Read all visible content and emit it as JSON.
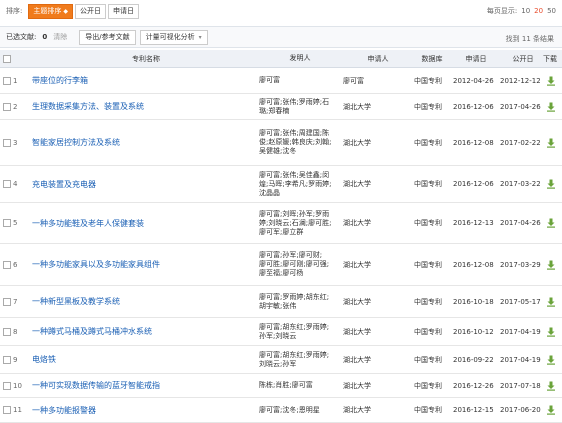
{
  "sortbar": {
    "label": "排序:",
    "buttons": [
      {
        "label": "主题排序",
        "arrow": "◆",
        "active": true
      },
      {
        "label": "公开日",
        "active": false
      },
      {
        "label": "申请日",
        "active": false
      }
    ],
    "perpage_label": "每页显示:",
    "perpage_options": [
      "10",
      "20",
      "50"
    ],
    "perpage_selected": "20"
  },
  "toolbar": {
    "selected_label": "已选文献:",
    "selected_count": "0",
    "clear_label": "清除",
    "export_label": "导出/参考文献",
    "analysis_label": "计量可视化分析",
    "found_text": "找到 11 条结果"
  },
  "table": {
    "headers": {
      "title": "专利名称",
      "inventor": "发明人",
      "applicant": "申请人",
      "database": "数据库",
      "apply_date": "申请日",
      "pub_date": "公开日",
      "download": "下载"
    },
    "rows": [
      {
        "num": "1",
        "title": "带座位的行李箱",
        "inventor": [
          "廖可富"
        ],
        "applicant": "廖可富",
        "database": "中国专利",
        "apply_date": "2012-04-26",
        "pub_date": "2012-12-12"
      },
      {
        "num": "2",
        "title": "生理数据采集方法、装置及系统",
        "inventor": [
          "廖可富;张伟;罗雨婷;石",
          "璐;郑春楠"
        ],
        "applicant": "湖北大学",
        "database": "中国专利",
        "apply_date": "2016-12-06",
        "pub_date": "2017-04-26"
      },
      {
        "num": "3",
        "title": "智能家居控制方法及系统",
        "inventor": [
          "廖可富;张伟;周建国;陈",
          "俊;赵原媛;韩良庆;刘翰;",
          "吴健雄;沈冬"
        ],
        "applicant": "湖北大学",
        "database": "中国专利",
        "apply_date": "2016-12-08",
        "pub_date": "2017-02-22"
      },
      {
        "num": "4",
        "title": "充电装置及充电器",
        "inventor": [
          "廖可富;张伟;吴佳鑫;闵",
          "煌;马晖;李希凡;罗雨婷;",
          "沈晶晶"
        ],
        "applicant": "湖北大学",
        "database": "中国专利",
        "apply_date": "2016-12-06",
        "pub_date": "2017-03-22"
      },
      {
        "num": "5",
        "title": "一种多功能鞋及老年人保健套装",
        "inventor": [
          "廖可富;刘晖;孙军;罗雨",
          "婷;刘晓云;石澜;廖可胜;",
          "廖可军;廖立群"
        ],
        "applicant": "湖北大学",
        "database": "中国专利",
        "apply_date": "2016-12-13",
        "pub_date": "2017-04-26"
      },
      {
        "num": "6",
        "title": "一种多功能家具以及多功能家具组件",
        "inventor": [
          "廖可富;孙军;廖可财;",
          "廖可胜;廖可刚;廖可强;",
          "廖至福;廖可杨"
        ],
        "applicant": "湖北大学",
        "database": "中国专利",
        "apply_date": "2016-12-08",
        "pub_date": "2017-03-29"
      },
      {
        "num": "7",
        "title": "一种新型黑板及教学系统",
        "inventor": [
          "廖可富;罗雨婷;胡东红;",
          "胡宇敏;张伟"
        ],
        "applicant": "湖北大学",
        "database": "中国专利",
        "apply_date": "2016-10-18",
        "pub_date": "2017-05-17"
      },
      {
        "num": "8",
        "title": "一种蹲式马桶及蹲式马桶冲水系统",
        "inventor": [
          "廖可富;胡东红;罗雨婷;",
          "孙军;刘晓云"
        ],
        "applicant": "湖北大学",
        "database": "中国专利",
        "apply_date": "2016-10-12",
        "pub_date": "2017-04-19"
      },
      {
        "num": "9",
        "title": "电烙铁",
        "inventor": [
          "廖可富;胡东红;罗雨婷;",
          "刘晓云;孙军"
        ],
        "applicant": "湖北大学",
        "database": "中国专利",
        "apply_date": "2016-09-22",
        "pub_date": "2017-04-19"
      },
      {
        "num": "10",
        "title": "一种可实现数据传输的蓝牙智能戒指",
        "inventor": [
          "陈栋;肖胜;廖可富"
        ],
        "applicant": "湖北大学",
        "database": "中国专利",
        "apply_date": "2016-12-26",
        "pub_date": "2017-07-18"
      },
      {
        "num": "11",
        "title": "一种多功能报警器",
        "inventor": [
          "廖可富;沈冬;恩明星"
        ],
        "applicant": "湖北大学",
        "database": "中国专利",
        "apply_date": "2016-12-15",
        "pub_date": "2017-06-20"
      }
    ]
  },
  "colors": {
    "accent": "#f07b1c",
    "link": "#1a5fb4",
    "download": "#6aa33a",
    "perpage_selected": "#e84b2b"
  },
  "icons": {
    "download": "download-arrow-icon"
  }
}
